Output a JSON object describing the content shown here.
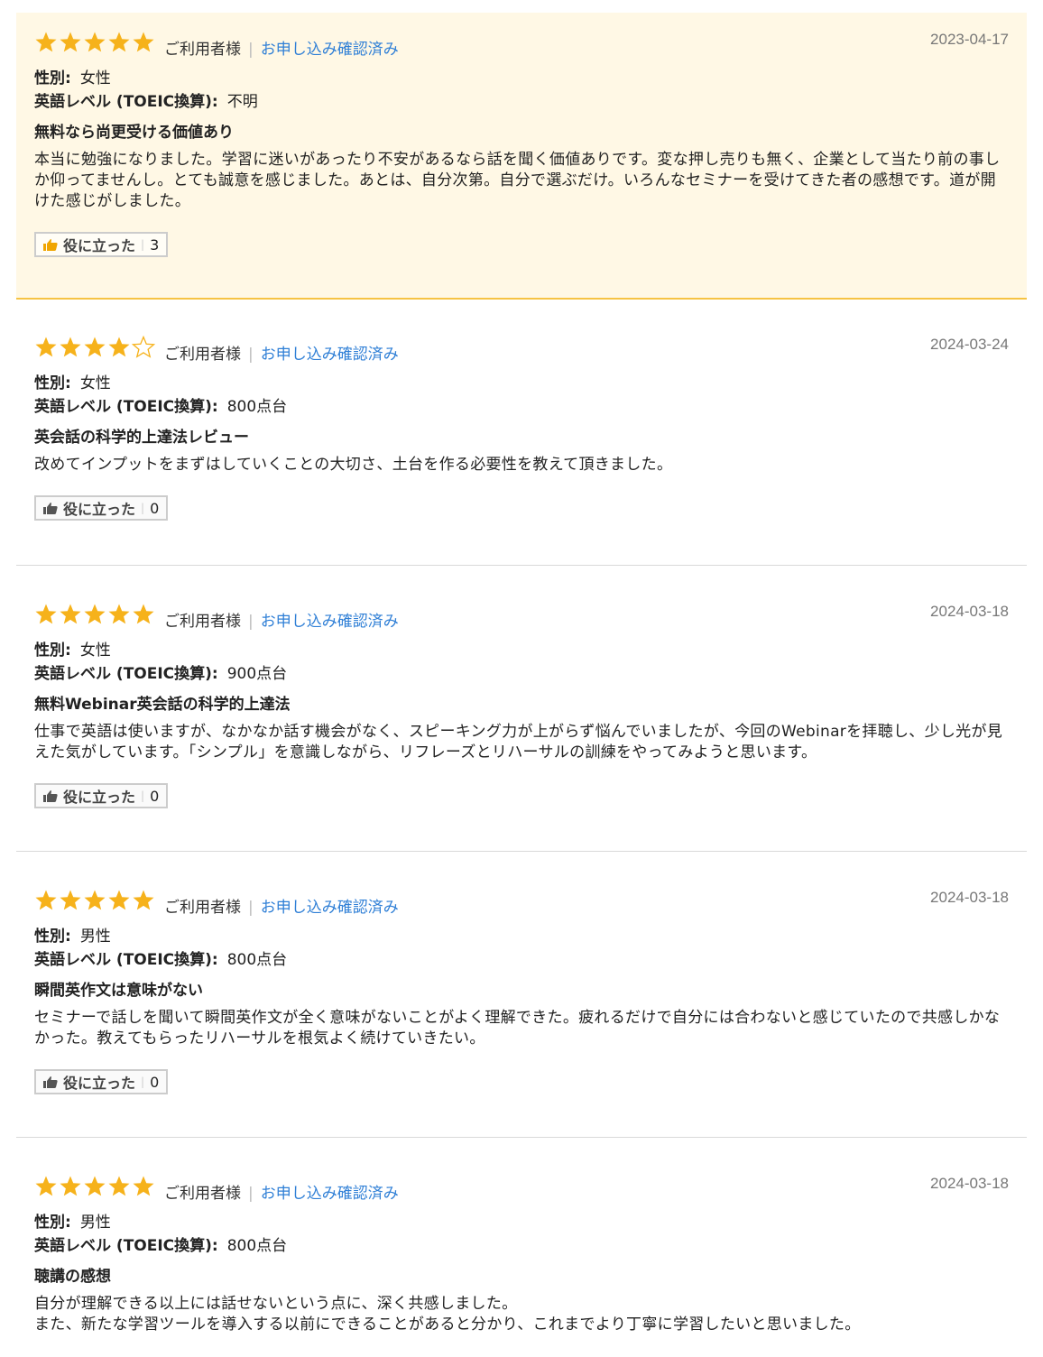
{
  "colors": {
    "star": "#f6b21b",
    "highlight_bg": "#fff8e5",
    "link": "#2f7fd6"
  },
  "icons": {
    "star": "star-icon",
    "thumb": "thumbs-up-icon"
  },
  "reviews": [
    {
      "rating": 5,
      "reviewer": "ご利用者様",
      "verified": "お申し込み確認済み",
      "date": "2023-04-17",
      "gender_label": "性別:",
      "gender": "女性",
      "level_label": "英語レベル (TOEIC換算):",
      "level": "不明",
      "title": "無料なら尚更受ける価値あり",
      "body": "本当に勉強になりました。学習に迷いがあったり不安があるなら話を聞く価値ありです。変な押し売りも無く、企業として当たり前の事しか仰ってませんし。とても誠意を感じました。あとは、自分次第。自分で選ぶだけ。いろんなセミナーを受けてきた者の感想です。道が開けた感じがしました。",
      "helpful_label": "役に立った",
      "helpful_count": "3"
    },
    {
      "rating": 4,
      "reviewer": "ご利用者様",
      "verified": "お申し込み確認済み",
      "date": "2024-03-24",
      "gender_label": "性別:",
      "gender": "女性",
      "level_label": "英語レベル (TOEIC換算):",
      "level": "800点台",
      "title": "英会話の科学的上達法レビュー",
      "body": "改めてインプットをまずはしていくことの大切さ、土台を作る必要性を教えて頂きました。",
      "helpful_label": "役に立った",
      "helpful_count": "0"
    },
    {
      "rating": 5,
      "reviewer": "ご利用者様",
      "verified": "お申し込み確認済み",
      "date": "2024-03-18",
      "gender_label": "性別:",
      "gender": "女性",
      "level_label": "英語レベル (TOEIC換算):",
      "level": "900点台",
      "title": "無料Webinar英会話の科学的上達法",
      "body": "仕事で英語は使いますが、なかなか話す機会がなく、スピーキング力が上がらず悩んでいましたが、今回のWebinarを拝聴し、少し光が見えた気がしています。「シンプル」を意識しながら、リフレーズとリハーサルの訓練をやってみようと思います。",
      "helpful_label": "役に立った",
      "helpful_count": "0"
    },
    {
      "rating": 5,
      "reviewer": "ご利用者様",
      "verified": "お申し込み確認済み",
      "date": "2024-03-18",
      "gender_label": "性別:",
      "gender": "男性",
      "level_label": "英語レベル (TOEIC換算):",
      "level": "800点台",
      "title": "瞬間英作文は意味がない",
      "body": "セミナーで話しを聞いて瞬間英作文が全く意味がないことがよく理解できた。疲れるだけで自分には合わないと感じていたので共感しかなかった。教えてもらったリハーサルを根気よく続けていきたい。",
      "helpful_label": "役に立った",
      "helpful_count": "0"
    },
    {
      "rating": 5,
      "reviewer": "ご利用者様",
      "verified": "お申し込み確認済み",
      "date": "2024-03-18",
      "gender_label": "性別:",
      "gender": "男性",
      "level_label": "英語レベル (TOEIC換算):",
      "level": "800点台",
      "title": "聴講の感想",
      "body_lines": [
        "自分が理解できる以上には話せないという点に、深く共感しました。",
        "また、新たな学習ツールを導入する以前にできることがあると分かり、これまでより丁寧に学習したいと思いました。"
      ]
    }
  ]
}
